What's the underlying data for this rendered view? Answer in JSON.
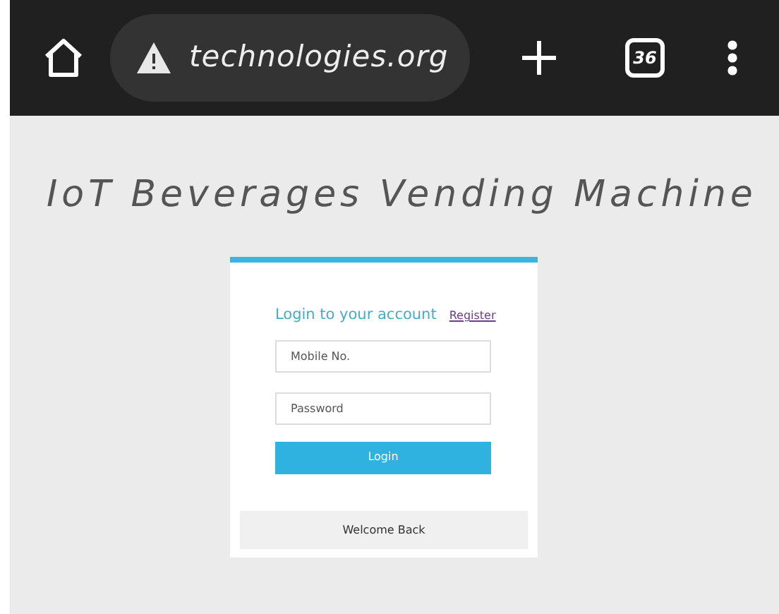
{
  "browser": {
    "url": "technologies.org",
    "tab_count": "36"
  },
  "page": {
    "title": "IoT Beverages Vending Machine"
  },
  "login": {
    "heading": "Login to your account",
    "register_link": "Register",
    "fields": [
      {
        "placeholder": "Mobile No."
      },
      {
        "placeholder": "Password"
      }
    ],
    "button": "Login",
    "footer": "Welcome Back"
  }
}
